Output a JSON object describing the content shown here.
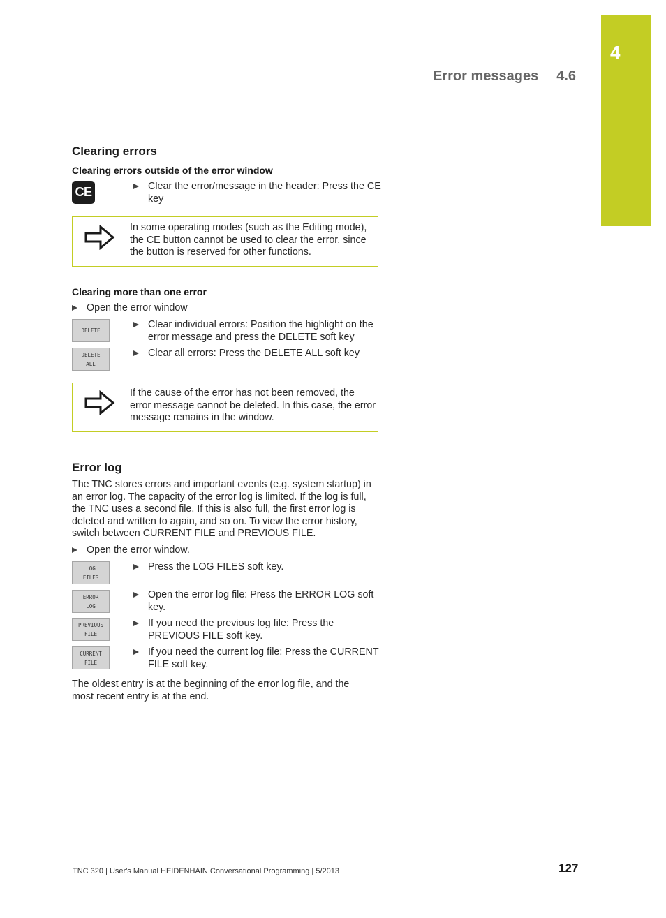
{
  "running_head": {
    "title": "Error messages",
    "section": "4.6"
  },
  "chapter_tab": {
    "number": "4",
    "color": "#c3cd24"
  },
  "clearing_errors": {
    "heading": "Clearing errors",
    "outside_window": {
      "subheading": "Clearing errors outside of the error window",
      "key_label": "CE",
      "step": "Clear the error/message in the header: Press the CE key",
      "note": "In some operating modes (such as the Editing mode), the CE button cannot be used to clear the error, since the button is reserved for other functions."
    },
    "more_than_one": {
      "subheading": "Clearing more than one error",
      "intro_step": "Open the error window",
      "steps": [
        {
          "softkey": [
            "DELETE"
          ],
          "text": "Clear individual errors: Position the highlight on the error message and press the DELETE soft key"
        },
        {
          "softkey": [
            "DELETE",
            "ALL"
          ],
          "text": "Clear all errors: Press the DELETE ALL soft key"
        }
      ],
      "note": "If the cause of the error has not been removed, the error message cannot be deleted. In this case, the error message remains in the window."
    }
  },
  "error_log": {
    "heading": "Error log",
    "paragraph": "The TNC stores errors and important events (e.g. system startup) in an error log. The capacity of the error log is limited. If the log is full, the TNC uses a second file. If this is also full, the first error log is deleted and written to again, and so on. To view the error history, switch between CURRENT FILE and PREVIOUS FILE.",
    "intro_step": "Open the error window.",
    "steps": [
      {
        "softkey": [
          "LOG",
          "FILES"
        ],
        "text": "Press the LOG FILES soft key."
      },
      {
        "softkey": [
          "ERROR",
          "LOG"
        ],
        "text": "Open the error log file: Press the ERROR LOG soft key."
      },
      {
        "softkey": [
          "PREVIOUS",
          "FILE"
        ],
        "text": "If you need the previous log file: Press the PREVIOUS FILE soft key."
      },
      {
        "softkey": [
          "CURRENT",
          "FILE"
        ],
        "text": "If you need the current log file: Press the CURRENT FILE soft key."
      }
    ],
    "closing": "The oldest entry is at the beginning of the error log file, and the most recent entry is at the end."
  },
  "footer": {
    "text": "TNC 320 | User's Manual HEIDENHAIN Conversational Programming | 5/2013",
    "page_number": "127"
  }
}
